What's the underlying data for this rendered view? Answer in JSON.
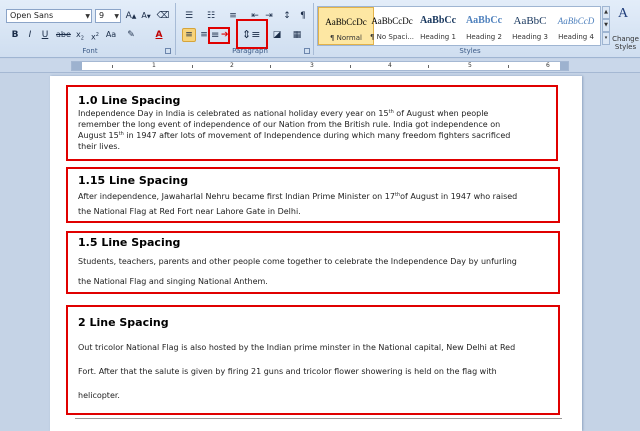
{
  "ribbon": {
    "font": {
      "name": "Open Sans",
      "size": "9",
      "group_label": "Font"
    },
    "paragraph": {
      "group_label": "Paragraph"
    },
    "styles": {
      "group_label": "Styles",
      "items": [
        {
          "preview": "AaBbCcDc",
          "name": "¶ Normal"
        },
        {
          "preview": "AaBbCcDc",
          "name": "¶ No Spaci..."
        },
        {
          "preview": "AaBbCc",
          "name": "Heading 1"
        },
        {
          "preview": "AaBbCc",
          "name": "Heading 2"
        },
        {
          "preview": "AaBbC",
          "name": "Heading 3"
        },
        {
          "preview": "AaBbCcD",
          "name": "Heading 4"
        }
      ],
      "change_styles_label": "Change Styles"
    }
  },
  "ruler": {
    "numbers": [
      "1",
      "2",
      "3",
      "4",
      "5",
      "6"
    ]
  },
  "document": {
    "sections": [
      {
        "heading": "1.0 Line Spacing",
        "lines": [
          {
            "a": "Independence Day in India is celebrated as national holiday every year on 15",
            "sup": "th",
            "b": " of August when people"
          },
          {
            "a": "remember the long event of independence of our Nation from the British rule. India got independence on"
          },
          {
            "a": "August 15",
            "sup": "th",
            "b": " in 1947 after lots of movement of Independence during which many freedom fighters sacrificed"
          },
          {
            "a": "their lives."
          }
        ]
      },
      {
        "heading": "1.15 Line Spacing",
        "lines": [
          {
            "a": "After independence, Jawaharlal Nehru became first Indian Prime Minister on 17",
            "sup": "th",
            "b": "of August in 1947 who raised"
          },
          {
            "a": "the National Flag at Red Fort near Lahore Gate in Delhi."
          }
        ]
      },
      {
        "heading": "1.5 Line Spacing",
        "lines": [
          {
            "a": "Students, teachers, parents and other people come together to celebrate the Independence Day by unfurling"
          },
          {
            "a": "the National Flag and singing National Anthem."
          }
        ]
      },
      {
        "heading": "2 Line Spacing",
        "lines": [
          {
            "a": "Out tricolor National Flag is also hosted by the Indian prime minster in the National capital, New Delhi at Red"
          },
          {
            "a": "Fort. After that the salute is given by firing 21 guns and tricolor flower showering is held on the flag with"
          },
          {
            "a": "helicopter."
          }
        ]
      }
    ]
  },
  "colors": {
    "highlight": "#e00000",
    "ribbon": "#dbe6f4",
    "font_color": "#c00000"
  }
}
